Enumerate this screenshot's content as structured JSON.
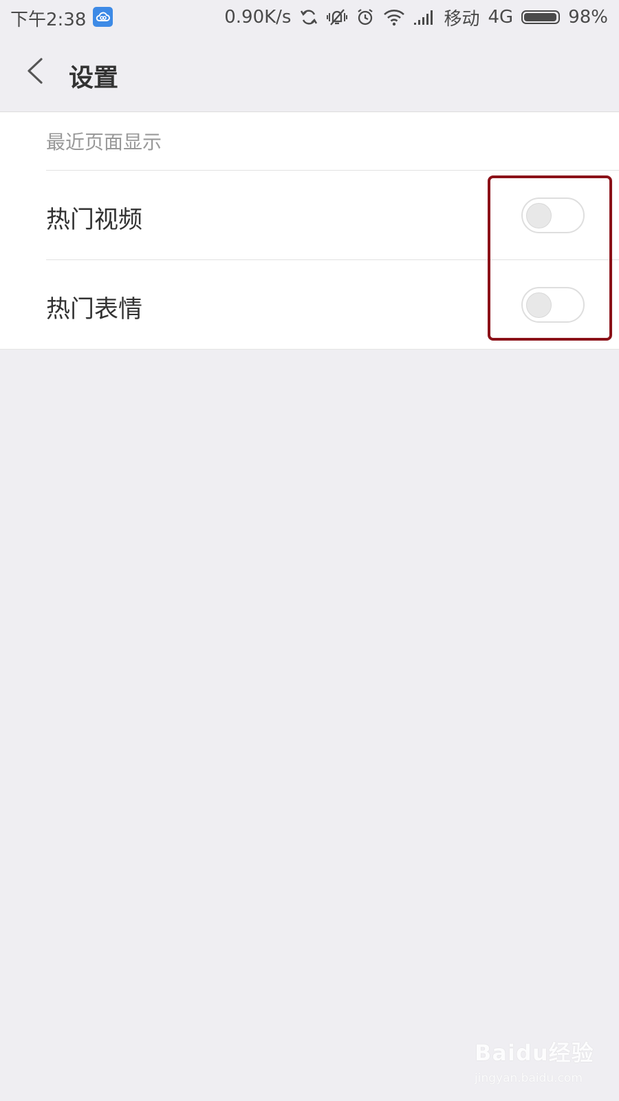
{
  "status_bar": {
    "time": "下午2:38",
    "app_icon": "cloud-icon",
    "net_speed": "0.90K/s",
    "icons": [
      "sync-icon",
      "vibrate-silent-icon",
      "alarm-icon",
      "wifi-icon",
      "signal-icon"
    ],
    "carrier": "移动",
    "network": "4G",
    "battery_level": 0.98,
    "battery_text": "98%"
  },
  "header": {
    "back_icon": "chevron-left-icon",
    "title": "设置"
  },
  "section": {
    "header": "最近页面显示",
    "items": [
      {
        "label": "热门视频",
        "toggle_on": false
      },
      {
        "label": "热门表情",
        "toggle_on": false
      }
    ]
  },
  "colors": {
    "background": "#efeef2",
    "card": "#ffffff",
    "highlight_border": "#8b1118",
    "status_cloud": "#3d8ae6"
  },
  "watermark": {
    "logo": "Baidu经验",
    "url": "jingyan.baidu.com"
  }
}
